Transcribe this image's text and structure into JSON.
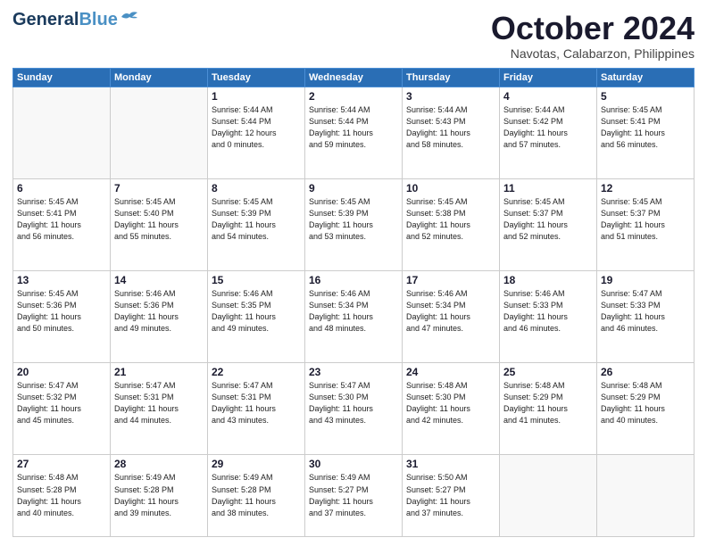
{
  "header": {
    "logo_line1": "General",
    "logo_line2": "Blue",
    "month": "October 2024",
    "location": "Navotas, Calabarzon, Philippines"
  },
  "weekdays": [
    "Sunday",
    "Monday",
    "Tuesday",
    "Wednesday",
    "Thursday",
    "Friday",
    "Saturday"
  ],
  "weeks": [
    [
      {
        "day": "",
        "detail": ""
      },
      {
        "day": "",
        "detail": ""
      },
      {
        "day": "1",
        "detail": "Sunrise: 5:44 AM\nSunset: 5:44 PM\nDaylight: 12 hours\nand 0 minutes."
      },
      {
        "day": "2",
        "detail": "Sunrise: 5:44 AM\nSunset: 5:44 PM\nDaylight: 11 hours\nand 59 minutes."
      },
      {
        "day": "3",
        "detail": "Sunrise: 5:44 AM\nSunset: 5:43 PM\nDaylight: 11 hours\nand 58 minutes."
      },
      {
        "day": "4",
        "detail": "Sunrise: 5:44 AM\nSunset: 5:42 PM\nDaylight: 11 hours\nand 57 minutes."
      },
      {
        "day": "5",
        "detail": "Sunrise: 5:45 AM\nSunset: 5:41 PM\nDaylight: 11 hours\nand 56 minutes."
      }
    ],
    [
      {
        "day": "6",
        "detail": "Sunrise: 5:45 AM\nSunset: 5:41 PM\nDaylight: 11 hours\nand 56 minutes."
      },
      {
        "day": "7",
        "detail": "Sunrise: 5:45 AM\nSunset: 5:40 PM\nDaylight: 11 hours\nand 55 minutes."
      },
      {
        "day": "8",
        "detail": "Sunrise: 5:45 AM\nSunset: 5:39 PM\nDaylight: 11 hours\nand 54 minutes."
      },
      {
        "day": "9",
        "detail": "Sunrise: 5:45 AM\nSunset: 5:39 PM\nDaylight: 11 hours\nand 53 minutes."
      },
      {
        "day": "10",
        "detail": "Sunrise: 5:45 AM\nSunset: 5:38 PM\nDaylight: 11 hours\nand 52 minutes."
      },
      {
        "day": "11",
        "detail": "Sunrise: 5:45 AM\nSunset: 5:37 PM\nDaylight: 11 hours\nand 52 minutes."
      },
      {
        "day": "12",
        "detail": "Sunrise: 5:45 AM\nSunset: 5:37 PM\nDaylight: 11 hours\nand 51 minutes."
      }
    ],
    [
      {
        "day": "13",
        "detail": "Sunrise: 5:45 AM\nSunset: 5:36 PM\nDaylight: 11 hours\nand 50 minutes."
      },
      {
        "day": "14",
        "detail": "Sunrise: 5:46 AM\nSunset: 5:36 PM\nDaylight: 11 hours\nand 49 minutes."
      },
      {
        "day": "15",
        "detail": "Sunrise: 5:46 AM\nSunset: 5:35 PM\nDaylight: 11 hours\nand 49 minutes."
      },
      {
        "day": "16",
        "detail": "Sunrise: 5:46 AM\nSunset: 5:34 PM\nDaylight: 11 hours\nand 48 minutes."
      },
      {
        "day": "17",
        "detail": "Sunrise: 5:46 AM\nSunset: 5:34 PM\nDaylight: 11 hours\nand 47 minutes."
      },
      {
        "day": "18",
        "detail": "Sunrise: 5:46 AM\nSunset: 5:33 PM\nDaylight: 11 hours\nand 46 minutes."
      },
      {
        "day": "19",
        "detail": "Sunrise: 5:47 AM\nSunset: 5:33 PM\nDaylight: 11 hours\nand 46 minutes."
      }
    ],
    [
      {
        "day": "20",
        "detail": "Sunrise: 5:47 AM\nSunset: 5:32 PM\nDaylight: 11 hours\nand 45 minutes."
      },
      {
        "day": "21",
        "detail": "Sunrise: 5:47 AM\nSunset: 5:31 PM\nDaylight: 11 hours\nand 44 minutes."
      },
      {
        "day": "22",
        "detail": "Sunrise: 5:47 AM\nSunset: 5:31 PM\nDaylight: 11 hours\nand 43 minutes."
      },
      {
        "day": "23",
        "detail": "Sunrise: 5:47 AM\nSunset: 5:30 PM\nDaylight: 11 hours\nand 43 minutes."
      },
      {
        "day": "24",
        "detail": "Sunrise: 5:48 AM\nSunset: 5:30 PM\nDaylight: 11 hours\nand 42 minutes."
      },
      {
        "day": "25",
        "detail": "Sunrise: 5:48 AM\nSunset: 5:29 PM\nDaylight: 11 hours\nand 41 minutes."
      },
      {
        "day": "26",
        "detail": "Sunrise: 5:48 AM\nSunset: 5:29 PM\nDaylight: 11 hours\nand 40 minutes."
      }
    ],
    [
      {
        "day": "27",
        "detail": "Sunrise: 5:48 AM\nSunset: 5:28 PM\nDaylight: 11 hours\nand 40 minutes."
      },
      {
        "day": "28",
        "detail": "Sunrise: 5:49 AM\nSunset: 5:28 PM\nDaylight: 11 hours\nand 39 minutes."
      },
      {
        "day": "29",
        "detail": "Sunrise: 5:49 AM\nSunset: 5:28 PM\nDaylight: 11 hours\nand 38 minutes."
      },
      {
        "day": "30",
        "detail": "Sunrise: 5:49 AM\nSunset: 5:27 PM\nDaylight: 11 hours\nand 37 minutes."
      },
      {
        "day": "31",
        "detail": "Sunrise: 5:50 AM\nSunset: 5:27 PM\nDaylight: 11 hours\nand 37 minutes."
      },
      {
        "day": "",
        "detail": ""
      },
      {
        "day": "",
        "detail": ""
      }
    ]
  ]
}
